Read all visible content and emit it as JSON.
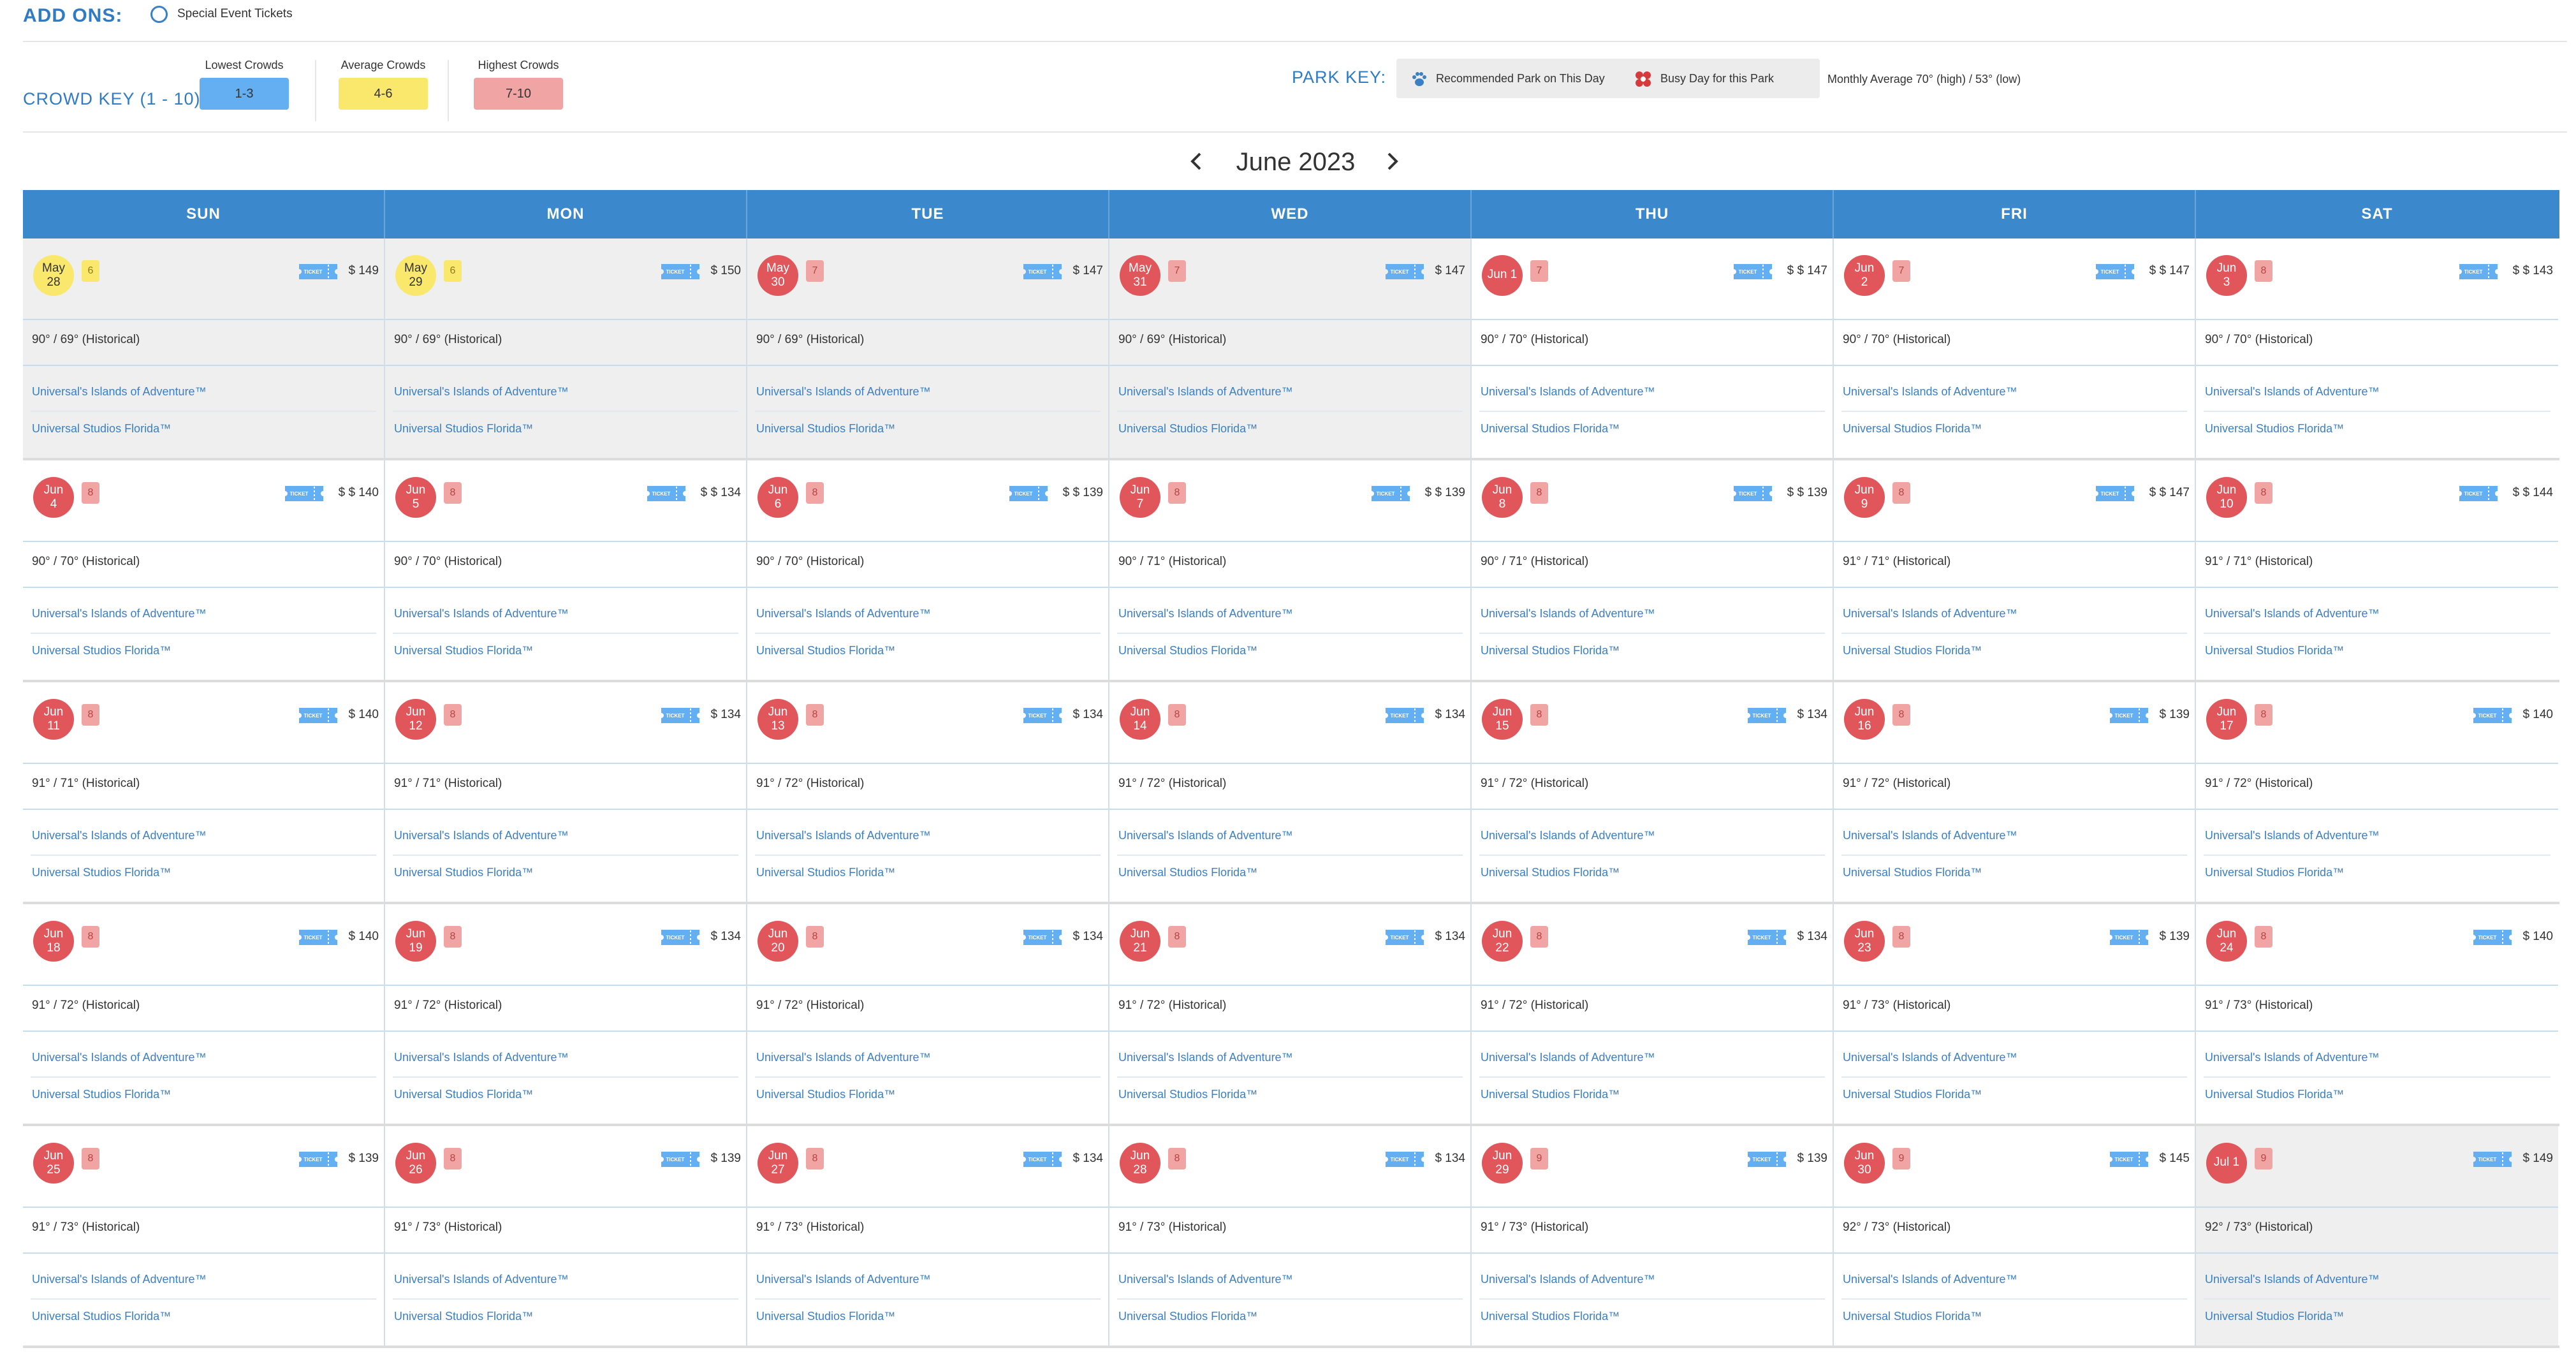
{
  "addons": {
    "title": "ADD ONS:",
    "option": "Special Event Tickets"
  },
  "crowd_key": {
    "title": "CROWD KEY (1 - 10):",
    "items": [
      {
        "label": "Lowest Crowds",
        "range": "1-3",
        "color": "#64aef2"
      },
      {
        "label": "Average Crowds",
        "range": "4-6",
        "color": "#f9e86c"
      },
      {
        "label": "Highest Crowds",
        "range": "7-10",
        "color": "#f1a4a4"
      }
    ]
  },
  "park_key": {
    "title": "PARK KEY:",
    "recommended": "Recommended Park on This Day",
    "busy": "Busy Day for this Park",
    "monthly_avg": "Monthly Average 70° (high) / 53° (low)"
  },
  "nav": {
    "month": "June 2023"
  },
  "days": [
    "SUN",
    "MON",
    "TUE",
    "WED",
    "THU",
    "FRI",
    "SAT"
  ],
  "weeks": [
    [
      {
        "m": "May",
        "d": "28",
        "c": "6",
        "col": "yellow",
        "p": "$ 149",
        "w": "90° / 69° (Historical)",
        "g": true
      },
      {
        "m": "May",
        "d": "29",
        "c": "6",
        "col": "yellow",
        "p": "$ 150",
        "w": "90° / 69° (Historical)",
        "g": true
      },
      {
        "m": "May",
        "d": "30",
        "c": "7",
        "col": "red",
        "p": "$ 147",
        "w": "90° / 69° (Historical)",
        "g": true
      },
      {
        "m": "May",
        "d": "31",
        "c": "7",
        "col": "red",
        "p": "$ 147",
        "w": "90° / 69° (Historical)",
        "g": true
      },
      {
        "m": "Jun 1",
        "d": "",
        "c": "7",
        "col": "red",
        "p": "$ $ 147",
        "w": "90° / 70° (Historical)",
        "g": false
      },
      {
        "m": "Jun",
        "d": "2",
        "c": "7",
        "col": "red",
        "p": "$ $ 147",
        "w": "90° / 70° (Historical)",
        "g": false
      },
      {
        "m": "Jun",
        "d": "3",
        "c": "8",
        "col": "red",
        "p": "$ $ 143",
        "w": "90° / 70° (Historical)",
        "g": false
      }
    ],
    [
      {
        "m": "Jun",
        "d": "4",
        "c": "8",
        "col": "red",
        "p": "$ $ 140",
        "w": "90° / 70° (Historical)",
        "g": false
      },
      {
        "m": "Jun",
        "d": "5",
        "c": "8",
        "col": "red",
        "p": "$ $ 134",
        "w": "90° / 70° (Historical)",
        "g": false
      },
      {
        "m": "Jun",
        "d": "6",
        "c": "8",
        "col": "red",
        "p": "$ $ 139",
        "w": "90° / 70° (Historical)",
        "g": false
      },
      {
        "m": "Jun",
        "d": "7",
        "c": "8",
        "col": "red",
        "p": "$ $ 139",
        "w": "90° / 71° (Historical)",
        "g": false
      },
      {
        "m": "Jun",
        "d": "8",
        "c": "8",
        "col": "red",
        "p": "$ $ 139",
        "w": "90° / 71° (Historical)",
        "g": false
      },
      {
        "m": "Jun",
        "d": "9",
        "c": "8",
        "col": "red",
        "p": "$ $ 147",
        "w": "91° / 71° (Historical)",
        "g": false
      },
      {
        "m": "Jun",
        "d": "10",
        "c": "8",
        "col": "red",
        "p": "$ $ 144",
        "w": "91° / 71° (Historical)",
        "g": false
      }
    ],
    [
      {
        "m": "Jun",
        "d": "11",
        "c": "8",
        "col": "red",
        "p": "$ 140",
        "w": "91° / 71° (Historical)",
        "g": false
      },
      {
        "m": "Jun",
        "d": "12",
        "c": "8",
        "col": "red",
        "p": "$ 134",
        "w": "91° / 71° (Historical)",
        "g": false
      },
      {
        "m": "Jun",
        "d": "13",
        "c": "8",
        "col": "red",
        "p": "$ 134",
        "w": "91° / 72° (Historical)",
        "g": false
      },
      {
        "m": "Jun",
        "d": "14",
        "c": "8",
        "col": "red",
        "p": "$ 134",
        "w": "91° / 72° (Historical)",
        "g": false
      },
      {
        "m": "Jun",
        "d": "15",
        "c": "8",
        "col": "red",
        "p": "$ 134",
        "w": "91° / 72° (Historical)",
        "g": false
      },
      {
        "m": "Jun",
        "d": "16",
        "c": "8",
        "col": "red",
        "p": "$ 139",
        "w": "91° / 72° (Historical)",
        "g": false
      },
      {
        "m": "Jun",
        "d": "17",
        "c": "8",
        "col": "red",
        "p": "$ 140",
        "w": "91° / 72° (Historical)",
        "g": false
      }
    ],
    [
      {
        "m": "Jun",
        "d": "18",
        "c": "8",
        "col": "red",
        "p": "$ 140",
        "w": "91° / 72° (Historical)",
        "g": false
      },
      {
        "m": "Jun",
        "d": "19",
        "c": "8",
        "col": "red",
        "p": "$ 134",
        "w": "91° / 72° (Historical)",
        "g": false
      },
      {
        "m": "Jun",
        "d": "20",
        "c": "8",
        "col": "red",
        "p": "$ 134",
        "w": "91° / 72° (Historical)",
        "g": false
      },
      {
        "m": "Jun",
        "d": "21",
        "c": "8",
        "col": "red",
        "p": "$ 134",
        "w": "91° / 72° (Historical)",
        "g": false
      },
      {
        "m": "Jun",
        "d": "22",
        "c": "8",
        "col": "red",
        "p": "$ 134",
        "w": "91° / 72° (Historical)",
        "g": false
      },
      {
        "m": "Jun",
        "d": "23",
        "c": "8",
        "col": "red",
        "p": "$ 139",
        "w": "91° / 73° (Historical)",
        "g": false
      },
      {
        "m": "Jun",
        "d": "24",
        "c": "8",
        "col": "red",
        "p": "$ 140",
        "w": "91° / 73° (Historical)",
        "g": false
      }
    ],
    [
      {
        "m": "Jun",
        "d": "25",
        "c": "8",
        "col": "red",
        "p": "$ 139",
        "w": "91° / 73° (Historical)",
        "g": false
      },
      {
        "m": "Jun",
        "d": "26",
        "c": "8",
        "col": "red",
        "p": "$ 139",
        "w": "91° / 73° (Historical)",
        "g": false
      },
      {
        "m": "Jun",
        "d": "27",
        "c": "8",
        "col": "red",
        "p": "$ 134",
        "w": "91° / 73° (Historical)",
        "g": false
      },
      {
        "m": "Jun",
        "d": "28",
        "c": "8",
        "col": "red",
        "p": "$ 134",
        "w": "91° / 73° (Historical)",
        "g": false
      },
      {
        "m": "Jun",
        "d": "29",
        "c": "9",
        "col": "red",
        "p": "$ 139",
        "w": "91° / 73° (Historical)",
        "g": false
      },
      {
        "m": "Jun",
        "d": "30",
        "c": "9",
        "col": "red",
        "p": "$ 145",
        "w": "92° / 73° (Historical)",
        "g": false
      },
      {
        "m": "Jul 1",
        "d": "",
        "c": "9",
        "col": "red",
        "p": "$ 149",
        "w": "92° / 73° (Historical)",
        "g": true
      }
    ]
  ],
  "parks": [
    "Universal's Islands of Adventure™",
    "Universal Studios Florida™"
  ],
  "ticket_text": "TICKET"
}
